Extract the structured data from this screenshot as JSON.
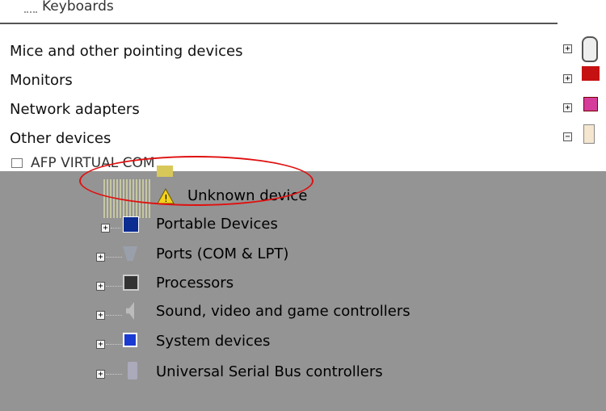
{
  "top_item": "Keyboards",
  "upper_items": [
    "Mice and other pointing devices",
    "Monitors",
    "Network adapters",
    "Other devices"
  ],
  "partial_item": "AFP VIRTUAL COM",
  "unknown_device": "Unknown device",
  "lower_items": [
    "Portable Devices",
    "Ports (COM & LPT)",
    "Processors",
    "Sound, video and game controllers",
    "System devices",
    "Universal Serial Bus controllers"
  ],
  "colors": {
    "annotation": "#e01010",
    "lower_bg": "#949494"
  },
  "icons": [
    "keyboard-icon",
    "mouse-icon",
    "monitor-icon",
    "network-icon",
    "other-devices-icon",
    "warning-icon",
    "portable-device-icon",
    "port-icon",
    "processor-icon",
    "speaker-icon",
    "system-icon",
    "usb-icon"
  ]
}
